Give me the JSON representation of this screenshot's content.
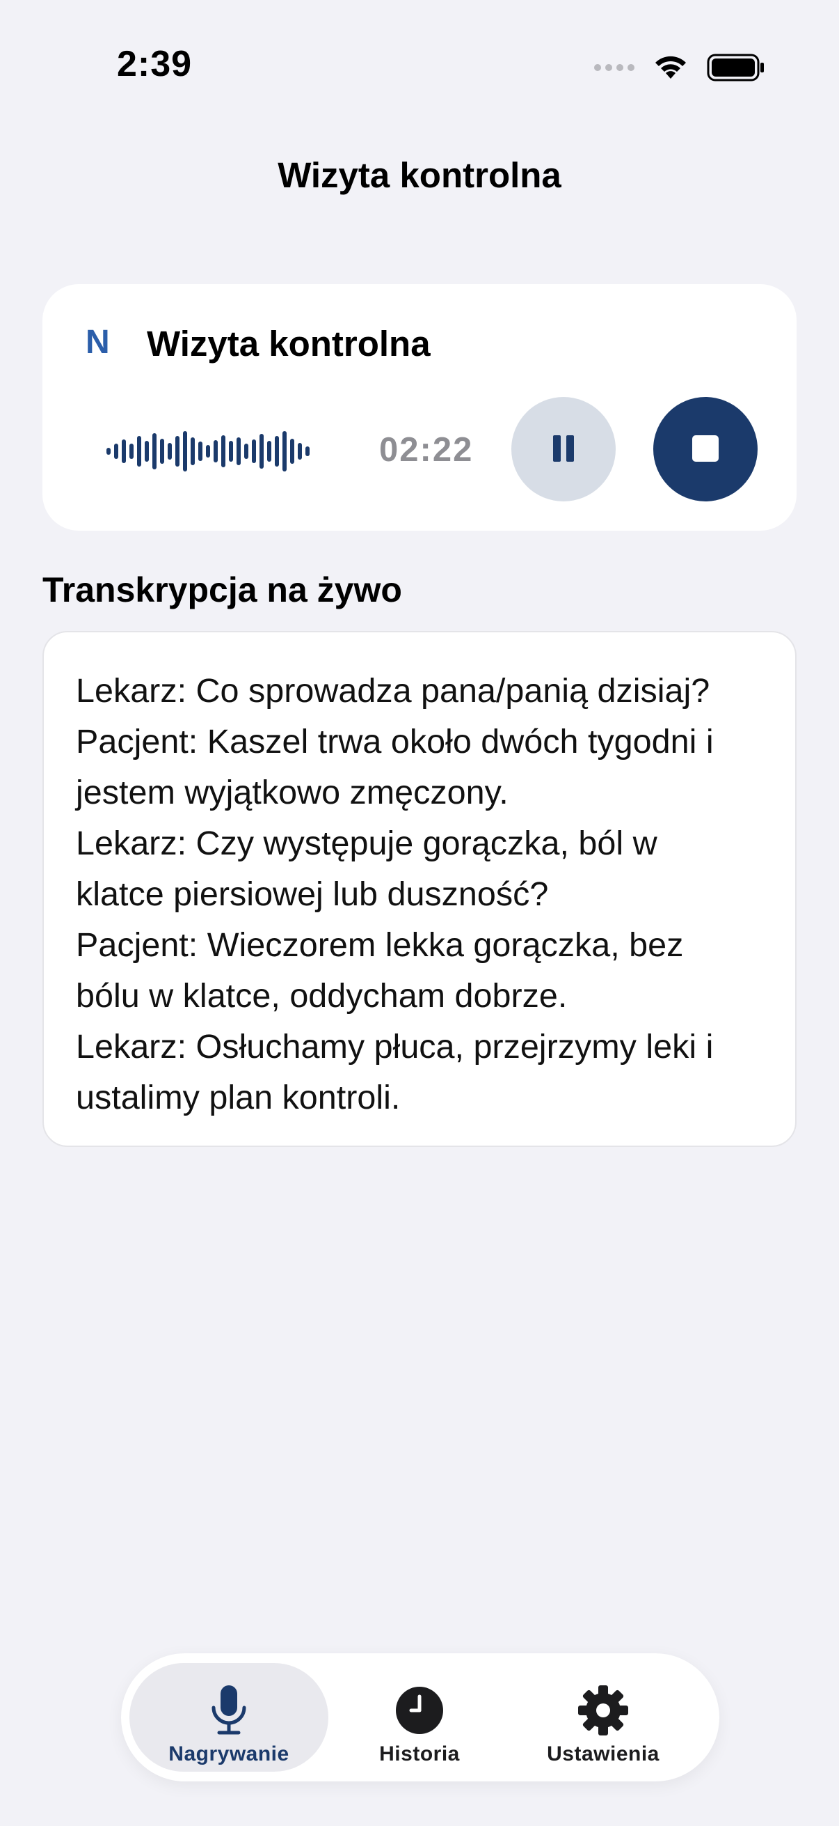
{
  "status_bar": {
    "time": "2:39"
  },
  "nav": {
    "title": "Wizyta kontrolna"
  },
  "recording_card": {
    "logo": "N",
    "title": "Wizyta kontrolna",
    "timer": "02:22",
    "accent_color": "#1B3A6B",
    "pause_icon": "pause-icon",
    "stop_icon": "stop-icon"
  },
  "transcription": {
    "heading": "Transkrypcja na żywo",
    "lines": [
      "Lekarz: Co sprowadza pana/panią dzisiaj?",
      "Pacjent: Kaszel trwa około dwóch tygodni i",
      "jestem wyjątkowo zmęczony.",
      "Lekarz: Czy występuje gorączka, ból w",
      "klatce piersiowej lub duszność?",
      "Pacjent: Wieczorem lekka gorączka, bez",
      "bólu w klatce, oddycham dobrze.",
      "Lekarz: Osłuchamy płuca, przejrzymy leki i",
      "ustalimy plan kontroli."
    ]
  },
  "tabbar": {
    "tabs": [
      {
        "label": "Nagrywanie",
        "icon": "microphone-icon",
        "active": true
      },
      {
        "label": "Historia",
        "icon": "clock-icon",
        "active": false
      },
      {
        "label": "Ustawienia",
        "icon": "gear-icon",
        "active": false
      }
    ]
  }
}
